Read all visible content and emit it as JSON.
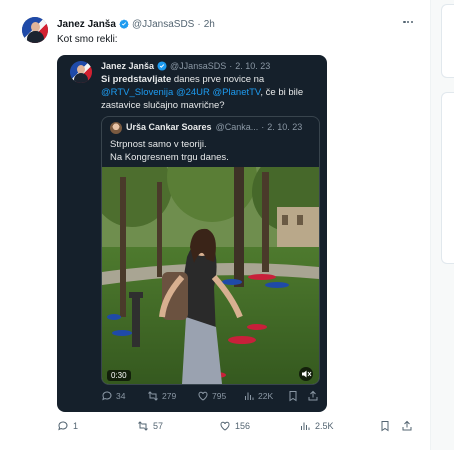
{
  "tweet": {
    "author_name": "Janez Janša",
    "handle": "@JJansaSDS",
    "time": "2h",
    "text": "Kot smo rekli:",
    "actions": {
      "replies": "1",
      "reposts": "57",
      "likes": "156",
      "views": "2.5K"
    }
  },
  "quoted": {
    "author_name": "Janez Janša",
    "handle": "@JJansaSDS",
    "date": "2. 10. 23",
    "text_bold": "Si predstavljate",
    "text_1": " danes prve novice na",
    "mention_1": "@RTV_Slovenija",
    "mention_2": "@24UR",
    "mention_3": "@PlanetTV",
    "text_2": ", če bi bile zastavice slučajno mavrične?",
    "actions": {
      "replies": "34",
      "reposts": "279",
      "likes": "795",
      "views": "22K"
    }
  },
  "inner_quote": {
    "author_name": "Urša Cankar Soares",
    "handle": "@Canka...",
    "date": "2. 10. 23",
    "line_1": "Strpnost samo v teoriji.",
    "line_2": "Na Kongresnem trgu danes.",
    "video_time": "0:30"
  },
  "colors": {
    "accent": "#1d9bf0",
    "dark_card": "#15202b",
    "muted": "#536471"
  }
}
